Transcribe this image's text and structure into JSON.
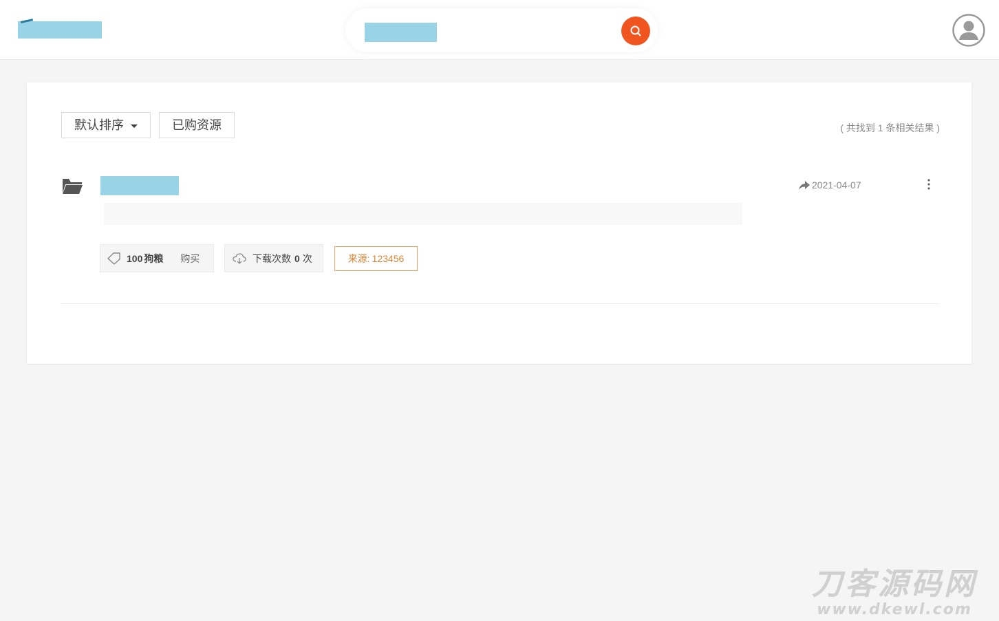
{
  "header": {
    "search": {
      "value": "",
      "placeholder": ""
    },
    "icons": {
      "search": "search-icon",
      "avatar": "user-avatar-icon"
    },
    "accent_color": "#f0551f",
    "redacted_color": "#98d3e6"
  },
  "toolbar": {
    "sort_label": "默认排序",
    "bought_label": "已购资源",
    "result_count": "( 共找到 1 条相关结果 )"
  },
  "results": [
    {
      "date": "2021-04-07",
      "price_value": "100",
      "price_unit": "狗粮",
      "buy_label": "购买",
      "download_label": "下载次数",
      "download_count": "0",
      "download_suffix": "次",
      "source_label": "来源:",
      "source_value": "123456",
      "icons": {
        "type": "folder-open-icon",
        "share": "share-icon",
        "more": "more-vertical-icon",
        "price": "tag-icon",
        "download": "cloud-download-icon"
      }
    }
  ],
  "watermark": {
    "main": "刀客源码网",
    "url": "www.dkewl.com"
  }
}
